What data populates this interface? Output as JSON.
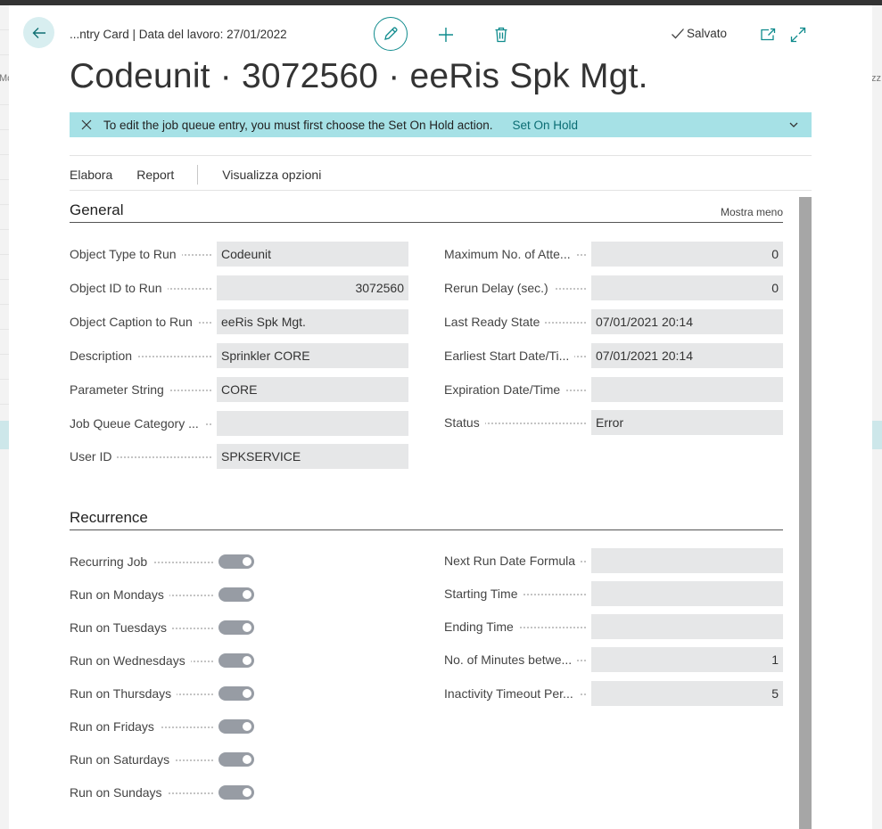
{
  "header": {
    "breadcrumb": "...ntry Card | Data del lavoro: 27/01/2022",
    "saved_label": "Salvato",
    "title": "Codeunit · 3072560 · eeRis Spk Mgt."
  },
  "background": {
    "left_fragment": "Mc",
    "right_fragment": "zz"
  },
  "notice": {
    "message": "To edit the job queue entry, you must first choose the Set On Hold action.",
    "action": "Set On Hold"
  },
  "actions": {
    "process": "Elabora",
    "report": "Report",
    "view_options": "Visualizza opzioni"
  },
  "general": {
    "title": "General",
    "show_less": "Mostra meno",
    "left": [
      {
        "label": "Object Type to Run",
        "value": "Codeunit"
      },
      {
        "label": "Object ID to Run",
        "value": "3072560"
      },
      {
        "label": "Object Caption to Run",
        "value": "eeRis Spk Mgt."
      },
      {
        "label": "Description",
        "value": "Sprinkler CORE"
      },
      {
        "label": "Parameter String",
        "value": "CORE"
      },
      {
        "label": "Job Queue Category ...",
        "value": ""
      },
      {
        "label": "User ID",
        "value": "SPKSERVICE"
      }
    ],
    "right": [
      {
        "label": "Maximum No. of Atte...",
        "value": "0"
      },
      {
        "label": "Rerun Delay (sec.)",
        "value": "0"
      },
      {
        "label": "Last Ready State",
        "value": "07/01/2021 20:14"
      },
      {
        "label": "Earliest Start Date/Ti...",
        "value": "07/01/2021 20:14"
      },
      {
        "label": "Expiration Date/Time",
        "value": ""
      },
      {
        "label": "Status",
        "value": "Error"
      }
    ]
  },
  "recurrence": {
    "title": "Recurrence",
    "left": [
      {
        "label": "Recurring Job",
        "value": "on"
      },
      {
        "label": "Run on Mondays",
        "value": "on"
      },
      {
        "label": "Run on Tuesdays",
        "value": "on"
      },
      {
        "label": "Run on Wednesdays",
        "value": "on"
      },
      {
        "label": "Run on Thursdays",
        "value": "on"
      },
      {
        "label": "Run on Fridays",
        "value": "on"
      },
      {
        "label": "Run on Saturdays",
        "value": "on"
      },
      {
        "label": "Run on Sundays",
        "value": "on"
      }
    ],
    "right": [
      {
        "label": "Next Run Date Formula",
        "value": ""
      },
      {
        "label": "Starting Time",
        "value": ""
      },
      {
        "label": "Ending Time",
        "value": ""
      },
      {
        "label": "No. of Minutes betwe...",
        "value": "1"
      },
      {
        "label": "Inactivity Timeout Per...",
        "value": "5"
      }
    ]
  },
  "colors": {
    "accent": "#0f8b8d",
    "notice_bg": "#a6e1e6",
    "field_bg": "#e6e7e8",
    "toggle_on": "#979ca4"
  }
}
